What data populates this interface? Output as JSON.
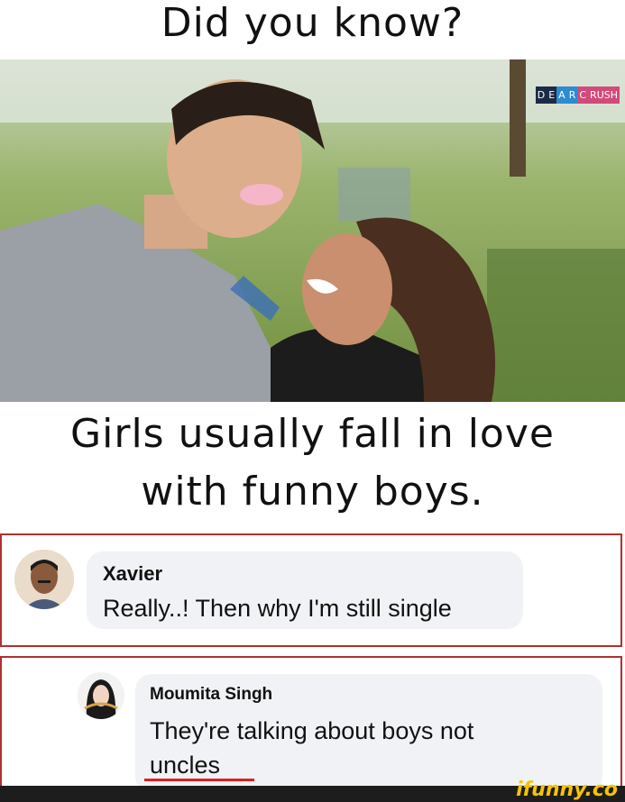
{
  "title": "Did you know?",
  "watermark": [
    "D",
    "E",
    "A",
    "R",
    "C",
    "RUSH"
  ],
  "caption_line1": "Girls usually fall in love",
  "caption_line2": "with funny boys.",
  "comment1": {
    "name": "Xavier",
    "text": "Really..! Then why I'm still single"
  },
  "comment2": {
    "name": "Moumita Singh",
    "text_line1": "They're talking about boys not",
    "text_line2": "uncles"
  },
  "brand": "ifunny.co",
  "colors": {
    "border_red": "#b03030",
    "underline_red": "#e02020",
    "bubble": "#f0f2f5",
    "brand_yellow": "#f5c400"
  }
}
